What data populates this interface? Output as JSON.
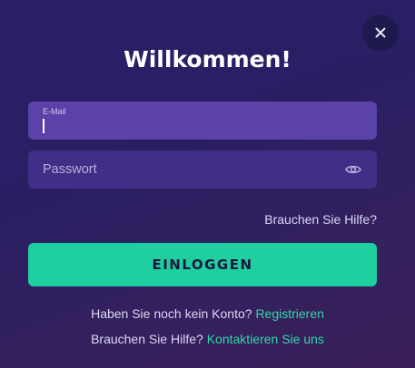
{
  "dialog": {
    "title": "Willkommen!",
    "close_icon": "close-icon"
  },
  "email": {
    "label": "E-Mail",
    "value": ""
  },
  "password": {
    "placeholder": "Passwort",
    "value": "",
    "toggle_icon": "eye-icon"
  },
  "help_link": "Brauchen Sie Hilfe?",
  "login_button": "EINLOGGEN",
  "register": {
    "prompt": "Haben Sie noch kein Konto?",
    "link": "Registrieren"
  },
  "support": {
    "prompt": "Brauchen Sie Hilfe?",
    "link": "Kontaktieren Sie uns"
  },
  "colors": {
    "background": "#2a2068",
    "email_field": "#5a42a8",
    "password_field": "#412f87",
    "accent": "#1ecfa0",
    "link": "#32d6a9"
  }
}
